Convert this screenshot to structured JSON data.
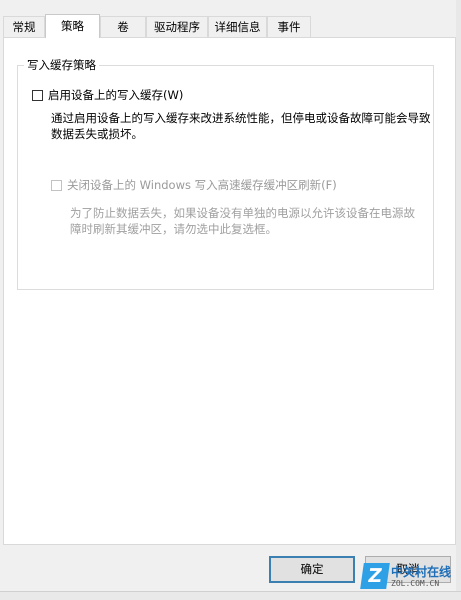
{
  "tabs": [
    {
      "label": "常规"
    },
    {
      "label": "策略",
      "active": true
    },
    {
      "label": "卷"
    },
    {
      "label": "驱动程序"
    },
    {
      "label": "详细信息"
    },
    {
      "label": "事件"
    }
  ],
  "group": {
    "title": "写入缓存策略",
    "enable_cache": {
      "label": "启用设备上的写入缓存(W)",
      "checked": false,
      "description": "通过启用设备上的写入缓存来改进系统性能，但停电或设备故障可能会导致数据丢失或损坏。"
    },
    "disable_flush": {
      "label": "关闭设备上的 Windows 写入高速缓存缓冲区刷新(F)",
      "checked": false,
      "enabled": false,
      "description": "为了防止数据丢失，如果设备没有单独的电源以允许该设备在电源故障时刷新其缓冲区，请勿选中此复选框。"
    }
  },
  "buttons": {
    "ok": "确定",
    "cancel": "取消"
  },
  "watermark": {
    "logo": "Z",
    "main": "中关村在线",
    "sub": "ZOL.COM.CN"
  }
}
